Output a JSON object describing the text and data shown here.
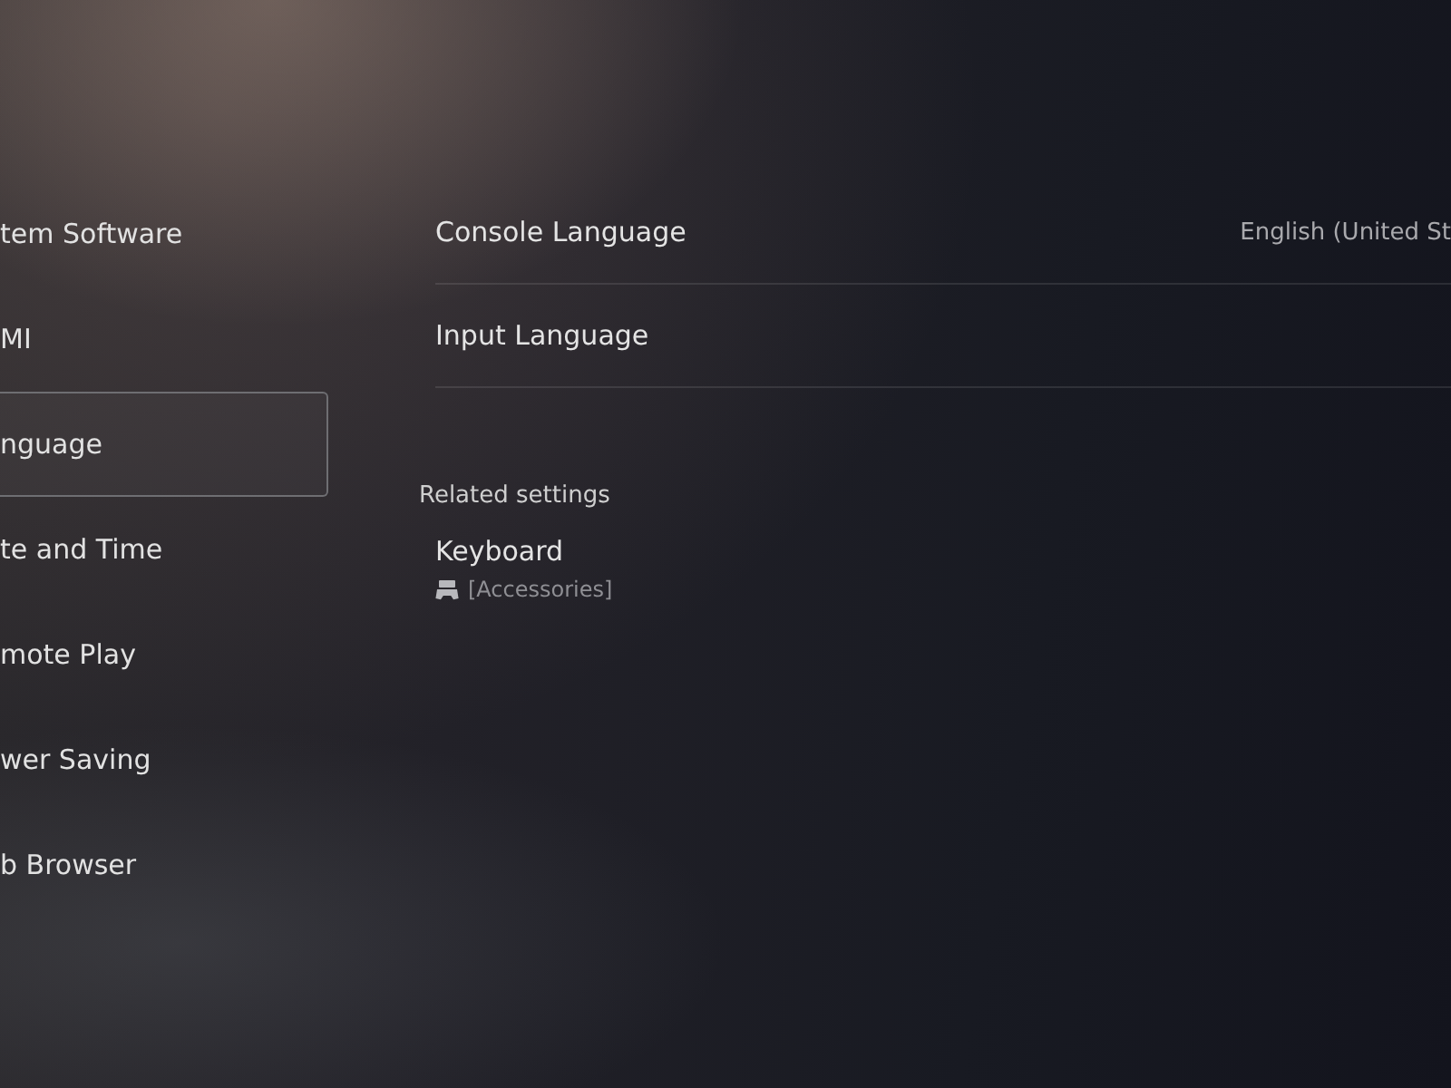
{
  "sidebar": {
    "items": [
      {
        "label": "tem Software",
        "selected": false
      },
      {
        "label": "MI",
        "selected": false
      },
      {
        "label": "nguage",
        "selected": true
      },
      {
        "label": "te and Time",
        "selected": false
      },
      {
        "label": "mote Play",
        "selected": false
      },
      {
        "label": "wer Saving",
        "selected": false
      },
      {
        "label": "b Browser",
        "selected": false
      }
    ]
  },
  "settings": {
    "items": [
      {
        "label": "Console Language",
        "value": "English (United St"
      },
      {
        "label": "Input Language"
      }
    ]
  },
  "related_settings": {
    "heading": "Related settings",
    "items": [
      {
        "label": "Keyboard",
        "category": "[Accessories]"
      }
    ]
  }
}
